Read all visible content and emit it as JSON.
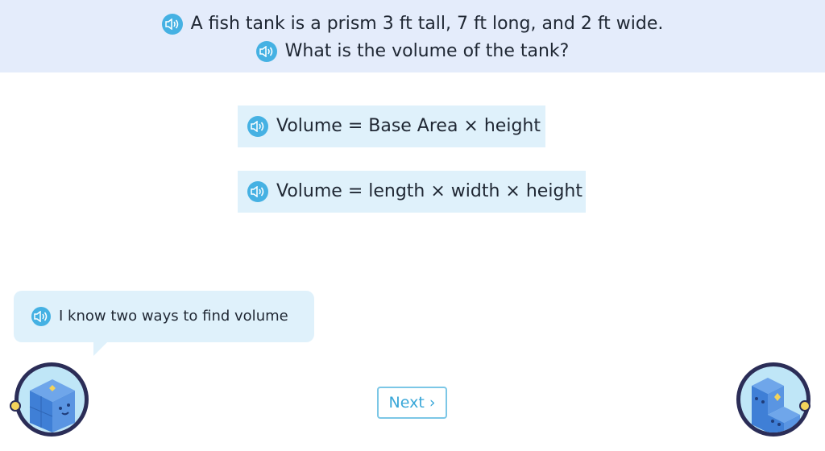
{
  "question": {
    "line1": "A fish tank is a prism 3 ft tall, 7 ft long, and 2 ft wide.",
    "line2": "What is the volume of the tank?"
  },
  "formulas": [
    {
      "text": "Volume = Base Area × height"
    },
    {
      "text": "Volume = length × width × height"
    }
  ],
  "speech_bubble": {
    "text": "I know two ways to find volume"
  },
  "next_button": {
    "label": "Next ›"
  },
  "icons": {
    "speaker": "speaker-icon",
    "left_avatar": "blue-cube-character-avatar",
    "right_avatar": "blue-cube-stairs-character-avatar"
  },
  "colors": {
    "header_bg": "#e4ecfb",
    "formula_bg": "#dff1fb",
    "speaker_icon": "#45b1e3",
    "next_button": "#3aa7d8",
    "avatar_ring": "#2b2d57"
  }
}
